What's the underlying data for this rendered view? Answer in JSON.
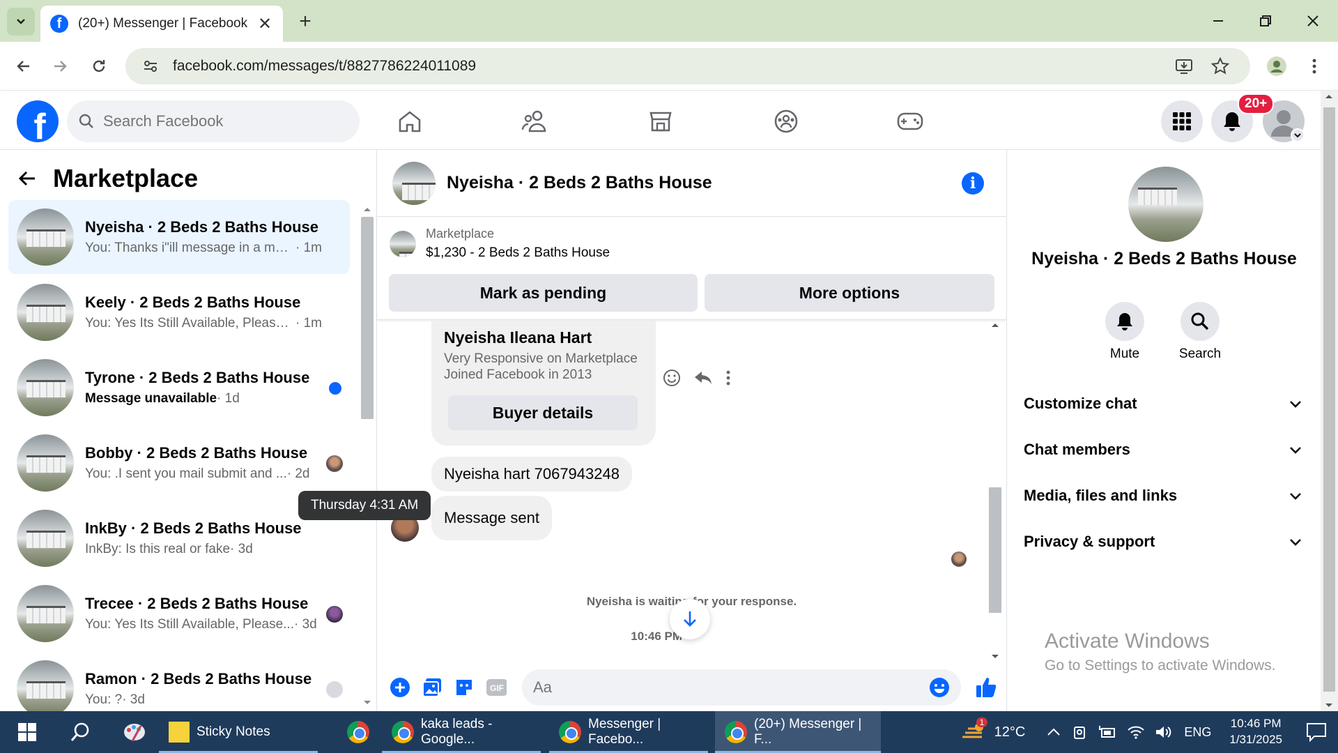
{
  "browser": {
    "tab_title": "(20+) Messenger | Facebook",
    "tab_close": "✕",
    "new_tab": "+",
    "url": "facebook.com/messages/t/8827786224011089"
  },
  "fb": {
    "search_placeholder": "Search Facebook",
    "notifications_badge": "20+",
    "brand_color": "#0866ff"
  },
  "left": {
    "title": "Marketplace",
    "conversations": [
      {
        "name": "Nyeisha · 2 Beds 2 Baths House",
        "preview": "You: Thanks i\"ill message in a mo...",
        "time": "· 1m",
        "active": true
      },
      {
        "name": "Keely · 2 Beds 2 Baths House",
        "preview": "You: Yes Its Still Available, Please S...",
        "time": "· 1m"
      },
      {
        "name": "Tyrone · 2 Beds 2 Baths House",
        "preview": "Message unavailable",
        "time": " · 1d",
        "unread": true
      },
      {
        "name": "Bobby · 2 Beds 2 Baths House",
        "preview": "You: .I sent you mail submit and ...",
        "time": " · 2d"
      },
      {
        "name": "InkBy · 2 Beds 2 Baths House",
        "preview": "InkBy: Is this real or fake",
        "time": " · 3d"
      },
      {
        "name": "Trecee · 2 Beds 2 Baths House",
        "preview": "You: Yes Its Still Available, Please...",
        "time": " · 3d"
      },
      {
        "name": "Ramon · 2 Beds 2 Baths House",
        "preview": "You: ?",
        "time": " · 3d"
      }
    ],
    "tooltip": "Thursday 4:31 AM"
  },
  "chat": {
    "title": "Nyeisha · 2 Beds 2 Baths House",
    "listing_source": "Marketplace",
    "listing_price": "$1,230 - 2 Beds 2 Baths House",
    "mark_pending": "Mark as pending",
    "more_options": "More options",
    "buyer_name": "Nyeisha Ileana Hart",
    "buyer_line1": "Very Responsive on Marketplace",
    "buyer_line2": "Joined Facebook in 2013",
    "buyer_details": "Buyer details",
    "msg_phone": "Nyeisha hart 7067943248",
    "msg_sent": "Message sent",
    "waiting": "Nyeisha is waiting for your response.",
    "timestamp": "10:46 PM",
    "input_placeholder": "Aa"
  },
  "right": {
    "name": "Nyeisha · 2 Beds 2 Baths House",
    "mute": "Mute",
    "search": "Search",
    "rows": [
      "Customize chat",
      "Chat members",
      "Media, files and links",
      "Privacy & support"
    ],
    "activate_title": "Activate Windows",
    "activate_sub": "Go to Settings to activate Windows."
  },
  "taskbar": {
    "sticky_notes": "Sticky Notes",
    "app_kaka": "kaka leads - Google...",
    "app_messenger": "Messenger | Facebo...",
    "app_messenger2": "(20+) Messenger | F...",
    "weather": "12°C",
    "weather_badge": "1",
    "lang": "ENG",
    "time": "10:46 PM",
    "date": "1/31/2025"
  }
}
